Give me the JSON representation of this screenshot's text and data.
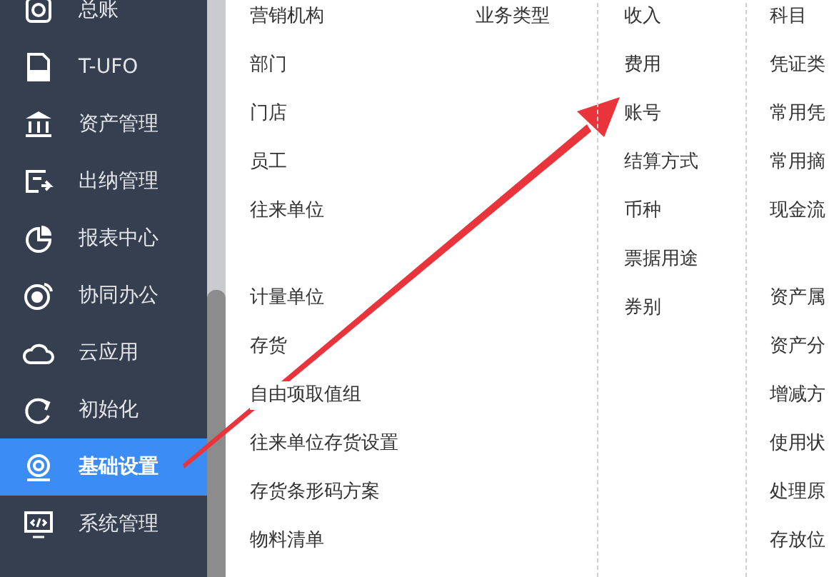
{
  "sidebar": {
    "items": [
      {
        "label": "总账",
        "selected": false
      },
      {
        "label": "T-UFO",
        "selected": false
      },
      {
        "label": "资产管理",
        "selected": false
      },
      {
        "label": "出纳管理",
        "selected": false
      },
      {
        "label": "报表中心",
        "selected": false
      },
      {
        "label": "协同办公",
        "selected": false
      },
      {
        "label": "云应用",
        "selected": false
      },
      {
        "label": "初始化",
        "selected": false
      },
      {
        "label": "基础设置",
        "selected": true
      },
      {
        "label": "系统管理",
        "selected": false
      }
    ]
  },
  "menu": {
    "columns": [
      {
        "groups": [
          [
            "营销机构",
            "部门",
            "门店",
            "员工",
            "往来单位"
          ],
          [
            "计量单位",
            "存货",
            "自由项取值组",
            "往来单位存货设置",
            "存货条形码方案",
            "物料清单"
          ]
        ]
      },
      {
        "groups": [
          [
            "业务类型"
          ]
        ]
      },
      {
        "groups": [
          [
            "收入",
            "费用",
            "账号",
            "结算方式",
            "币种",
            "票据用途",
            "券别"
          ]
        ]
      },
      {
        "groups": [
          [
            "科目",
            "凭证类",
            "常用凭",
            "常用摘",
            "现金流"
          ],
          [
            "资产属",
            "资产分",
            "增减方",
            "使用状",
            "处理原",
            "存放位"
          ]
        ]
      }
    ]
  }
}
